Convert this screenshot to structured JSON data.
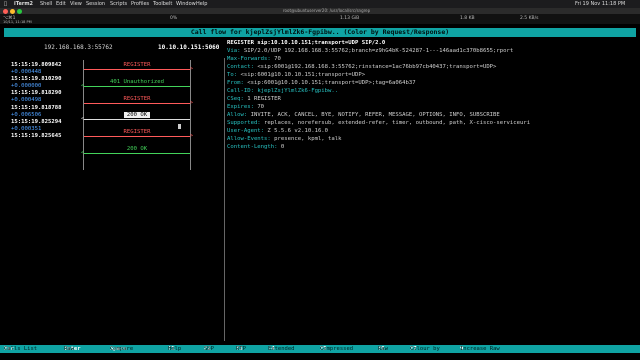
{
  "mac_menubar": {
    "app": "iTerm2",
    "items": [
      "Shell",
      "Edit",
      "View",
      "Session",
      "Scripts",
      "Profiles",
      "Toolbelt",
      "Window",
      "Help"
    ],
    "datetime": "Fri 19 Nov 11:18 PM"
  },
  "window": {
    "tab": "⌥⌘1",
    "title": "root@ubuntuserver20: /usr/local/src/sngrep"
  },
  "status_row": {
    "left": "10/11, 11:18 PM",
    "pct": "0%",
    "mem": "1.13 GiB",
    "net_down": "1.8 KB",
    "net_up": "2.5 KB/s"
  },
  "header": {
    "title": "Call flow for kjeplZsjYlmlZk6-Fgpibw.. (Color by Request/Response)"
  },
  "hosts": {
    "left": "192.168.168.3:55762",
    "right": "10.10.10.151:5060"
  },
  "flow": [
    {
      "time": "15:15:19.809842",
      "delta": "+0.000448",
      "label": "REGISTER",
      "dir": "right",
      "color": "red"
    },
    {
      "time": "15:15:19.810290",
      "delta": "+0.000000",
      "label": "401 Unauthorized",
      "dir": "left",
      "color": "green"
    },
    {
      "time": "15:15:19.818290",
      "delta": "+0.000498",
      "label": "REGISTER",
      "dir": "right",
      "color": "red"
    },
    {
      "time": "15:15:19.818788",
      "delta": "+0.006506",
      "label": "200 OK",
      "dir": "left",
      "color": "sel"
    },
    {
      "time": "15:15:19.825294",
      "delta": "+0.000351",
      "label": "REGISTER",
      "dir": "right",
      "color": "red"
    },
    {
      "time": "15:15:19.825645",
      "delta": "",
      "label": "200 OK",
      "dir": "left",
      "color": "green"
    }
  ],
  "detail": {
    "lines": [
      {
        "key": "",
        "value": "REGISTER sip:10.10.10.151;transport=UDP SIP/2.0"
      },
      {
        "key": "Via: ",
        "value": "SIP/2.0/UDP 192.168.168.3:55762;branch=z9hG4bK-524287-1---146aad1c370b8655;rport"
      },
      {
        "key": "Max-Forwards: ",
        "value": "70"
      },
      {
        "key": "Contact: ",
        "value": "<sip:6001@192.168.168.3:55762;rinstance=1ac76bb97cb40437;transport=UDP>"
      },
      {
        "key": "To: ",
        "value": "<sip:6001@10.10.10.151;transport=UDP>"
      },
      {
        "key": "From: ",
        "value": "<sip:6001@10.10.10.151;transport=UDP>;tag=6a064b37"
      },
      {
        "key": "Call-ID: ",
        "value": "kjeplZsjYlmlZk6-Fgpibw.."
      },
      {
        "key": "CSeq: ",
        "value": "1 REGISTER"
      },
      {
        "key": "Expires: ",
        "value": "70"
      },
      {
        "key": "Allow: ",
        "value": "INVITE, ACK, CANCEL, BYE, NOTIFY, REFER, MESSAGE, OPTIONS, INFO, SUBSCRIBE"
      },
      {
        "key": "Supported: ",
        "value": "replaces, norefersub, extended-refer, timer, outbound, path, X-cisco-serviceuri"
      },
      {
        "key": "User-Agent: ",
        "value": "Z 5.5.6 v2.10.16.0"
      },
      {
        "key": "Allow-Events: ",
        "value": "presence, kpml, talk"
      },
      {
        "key": "Content-Length: ",
        "value": "0"
      }
    ]
  },
  "footer": {
    "keys": [
      {
        "k": "Esc",
        "l": "Calls List"
      },
      {
        "k": "Enter",
        "l": "Raw"
      },
      {
        "k": "Space",
        "l": "Compare"
      },
      {
        "k": "F1",
        "l": "Help"
      },
      {
        "k": "F2",
        "l": "SDP"
      },
      {
        "k": "F3",
        "l": "RTP"
      },
      {
        "k": "F4",
        "l": "Extended"
      },
      {
        "k": "F5",
        "l": "Compressed"
      },
      {
        "k": "F6",
        "l": "Raw"
      },
      {
        "k": "F7",
        "l": "Colour by"
      },
      {
        "k": "9",
        "l": "Increase Raw"
      }
    ]
  },
  "colors": {
    "accent": "#0fa3a3",
    "request": "#ff5a5a",
    "response": "#43d35a",
    "delta": "#4fa0ff"
  }
}
